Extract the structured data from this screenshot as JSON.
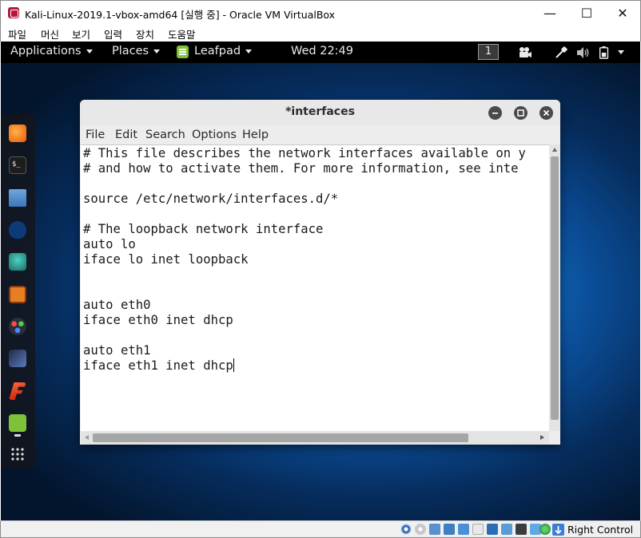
{
  "host": {
    "title": "Kali-Linux-2019.1-vbox-amd64 [실행 중] - Oracle VM VirtualBox",
    "controls": {
      "minimize": "—",
      "maximize": "☐",
      "close": "✕"
    },
    "menu": [
      "파일",
      "머신",
      "보기",
      "입력",
      "장치",
      "도움말"
    ],
    "host_key_label": "Right Control"
  },
  "panel": {
    "applications": "Applications",
    "places": "Places",
    "app_name": "Leafpad",
    "clock": "Wed 22:49",
    "workspace": "1"
  },
  "dock": {
    "icons": [
      "firefox-icon",
      "terminal-icon",
      "files-icon",
      "metasploit-icon",
      "armitage-icon",
      "burpsuite-icon",
      "maltego-icon",
      "beef-icon",
      "faraday-icon",
      "leafpad-icon",
      "show-apps-icon"
    ]
  },
  "leafpad": {
    "title": "*interfaces",
    "menu": [
      "File",
      "Edit",
      "Search",
      "Options",
      "Help"
    ],
    "lines": [
      "# This file describes the network interfaces available on y",
      "# and how to activate them. For more information, see inte",
      "",
      "source /etc/network/interfaces.d/*",
      "",
      "# The loopback network interface",
      "auto lo",
      "iface lo inet loopback",
      "",
      "",
      "auto eth0",
      "iface eth0 inet dhcp",
      "",
      "auto eth1",
      "iface eth1 inet dhcp"
    ]
  },
  "colors": {
    "vbox_brand": "#b5163b",
    "panel_bg": "#000000",
    "leafpad_green": "#7ec23a"
  }
}
